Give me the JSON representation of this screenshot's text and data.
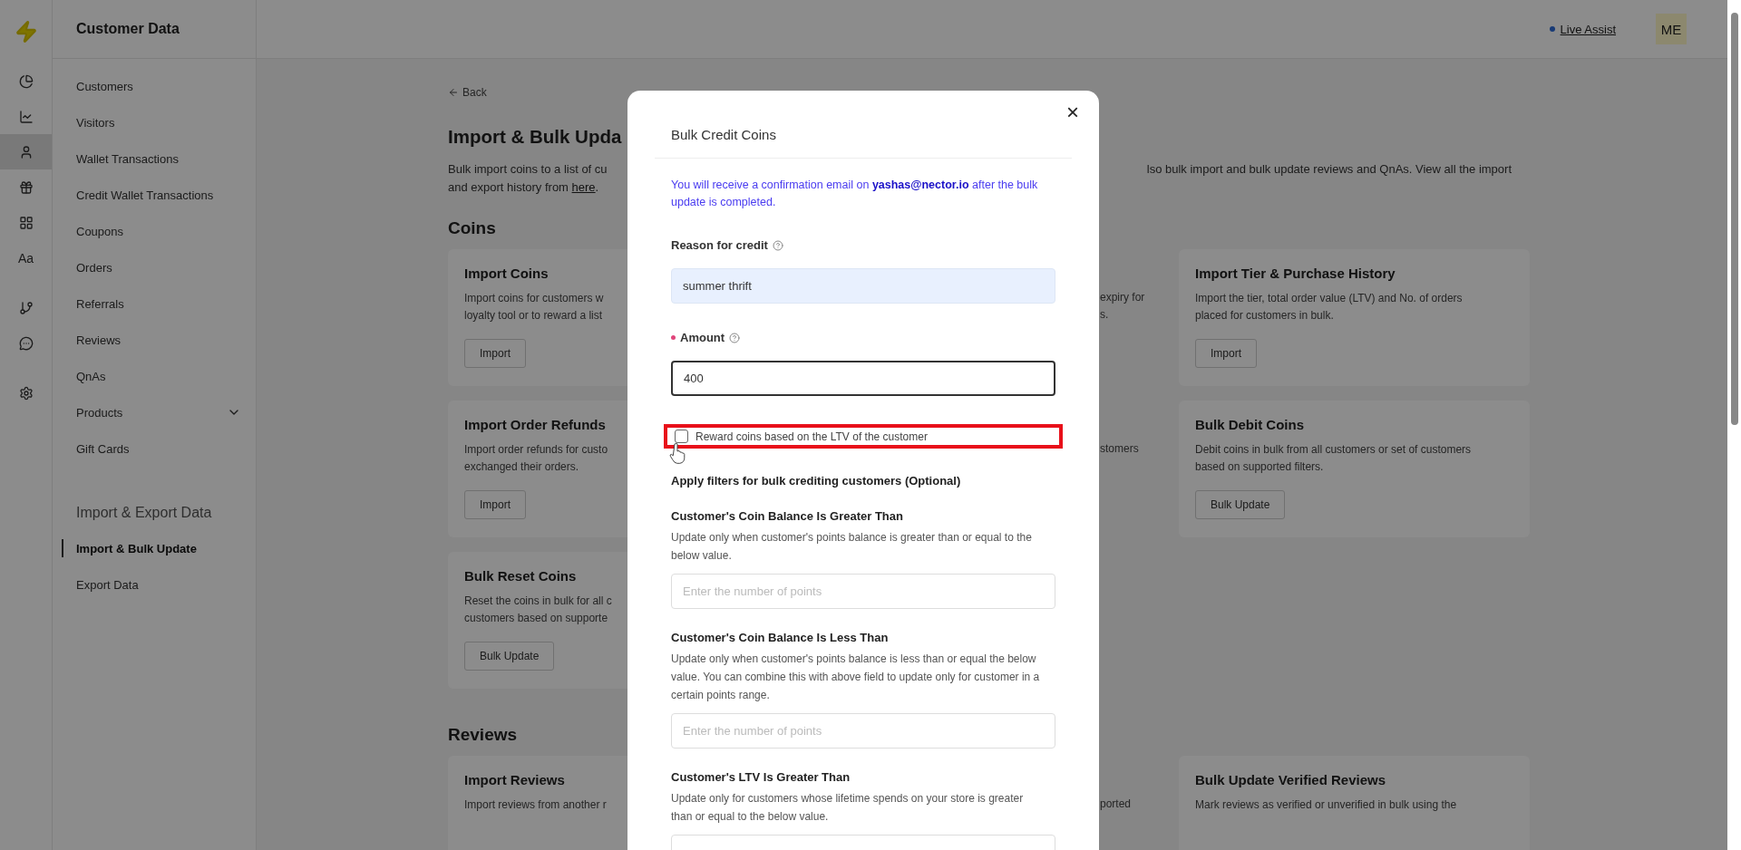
{
  "rail": {
    "groups": [
      [
        {
          "kind": "icon",
          "selected": false
        },
        {
          "kind": "icon",
          "selected": false
        },
        {
          "kind": "icon",
          "selected": true
        },
        {
          "kind": "icon",
          "selected": false
        },
        {
          "kind": "icon",
          "selected": false
        },
        {
          "kind": "glyph",
          "text": "Aa",
          "selected": false
        }
      ],
      [
        {
          "kind": "icon",
          "selected": false
        },
        {
          "kind": "icon",
          "selected": false
        }
      ],
      [
        {
          "kind": "icon",
          "selected": false
        }
      ]
    ]
  },
  "sidebar": {
    "title": "Customer Data",
    "items": [
      {
        "label": "Customers",
        "selected": false,
        "kind": "link"
      },
      {
        "label": "Visitors",
        "selected": false,
        "kind": "link"
      },
      {
        "label": "Wallet Transactions",
        "selected": false,
        "kind": "link"
      },
      {
        "label": "Credit Wallet Transactions",
        "selected": false,
        "kind": "link"
      },
      {
        "label": "Coupons",
        "selected": false,
        "kind": "link"
      },
      {
        "label": "Orders",
        "selected": false,
        "kind": "link"
      },
      {
        "label": "Referrals",
        "selected": false,
        "kind": "link"
      },
      {
        "label": "Reviews",
        "selected": false,
        "kind": "link"
      },
      {
        "label": "QnAs",
        "selected": false,
        "kind": "link"
      },
      {
        "label": "Products",
        "selected": false,
        "kind": "group"
      },
      {
        "label": "Gift Cards",
        "selected": false,
        "kind": "link"
      }
    ],
    "section": "Import & Export Data",
    "section_items": [
      {
        "label": "Import & Bulk Update",
        "selected": true,
        "kind": "link"
      },
      {
        "label": "Export Data",
        "selected": false,
        "kind": "link"
      }
    ]
  },
  "topbar": {
    "live_assist": "Live Assist",
    "avatar": "ME"
  },
  "page": {
    "back": "Back",
    "title": "Import & Bulk Upda",
    "description_left": "Bulk import coins to a list of cu",
    "description_right": "lso bulk import and bulk update reviews and QnAs. View all the import",
    "description_line2": "and export history from ",
    "link": "here",
    "description_line2_end": ".",
    "sections": [
      {
        "title": "Coins",
        "rows": [
          [
            {
              "title": "Import Coins",
              "description": [
                "Import coins for customers w",
                "loyalty tool or to reward a list"
              ],
              "button": "Import"
            },
            {
              "fragments": [
                "expiry for",
                "s."
              ]
            },
            {
              "title": "Import Tier & Purchase History",
              "description": [
                "Import the tier, total order value (LTV) and No. of orders",
                "placed for customers in bulk."
              ],
              "button": "Import"
            }
          ],
          [
            {
              "title": "Import Order Refunds",
              "description": [
                "Import order refunds for custo",
                "exchanged their orders."
              ],
              "button": "Import"
            },
            {
              "fragments": [
                "stomers"
              ]
            },
            {
              "title": "Bulk Debit Coins",
              "description": [
                "Debit coins in bulk from all customers or set of customers",
                "based on supported filters."
              ],
              "button": "Bulk Update"
            }
          ],
          [
            {
              "title": "Bulk Reset Coins",
              "description": [
                "Reset the coins in bulk for all c",
                "customers based on supporte"
              ],
              "button": "Bulk Update"
            }
          ]
        ]
      },
      {
        "title": "Reviews",
        "rows": [
          [
            {
              "title": "Import Reviews",
              "description": [
                "Import reviews from another r"
              ]
            },
            {
              "fragments": [
                "ported"
              ]
            },
            {
              "title": "Bulk Update Verified Reviews",
              "description": [
                "Mark reviews as verified or unverified in bulk using the"
              ]
            }
          ]
        ]
      }
    ]
  },
  "modal": {
    "title": "Bulk Credit Coins",
    "close": "×",
    "notice": "You will receive a confirmation email on **yashas@nector.io** after the bulk update is completed.",
    "fields": [
      {
        "label": "Reason for credit",
        "required": false,
        "help": true,
        "value": "summer thrift",
        "autofilled": true
      },
      {
        "label": "Amount",
        "required": true,
        "help": true,
        "value": "400",
        "autofilled": false
      }
    ],
    "checkbox": {
      "label": "Reward coins based on the LTV of the customer",
      "checked": false,
      "highlighted": true
    },
    "filters_heading": "Apply filters for bulk crediting customers (Optional)",
    "filters": [
      {
        "title": "Customer's Coin Balance Is Greater Than",
        "description": "Update only when customer's points balance is greater than or equal to the below value.",
        "placeholder": "Enter the number of points"
      },
      {
        "title": "Customer's Coin Balance Is Less Than",
        "description": "Update only when customer's points balance is less than or equal the below value. You can combine this with above field to update only for customer in a certain points range.",
        "placeholder": "Enter the number of points"
      },
      {
        "title": "Customer's LTV Is Greater Than",
        "description": "Update only for customers whose lifetime spends on your store is greater than or equal to the below value."
      }
    ]
  }
}
